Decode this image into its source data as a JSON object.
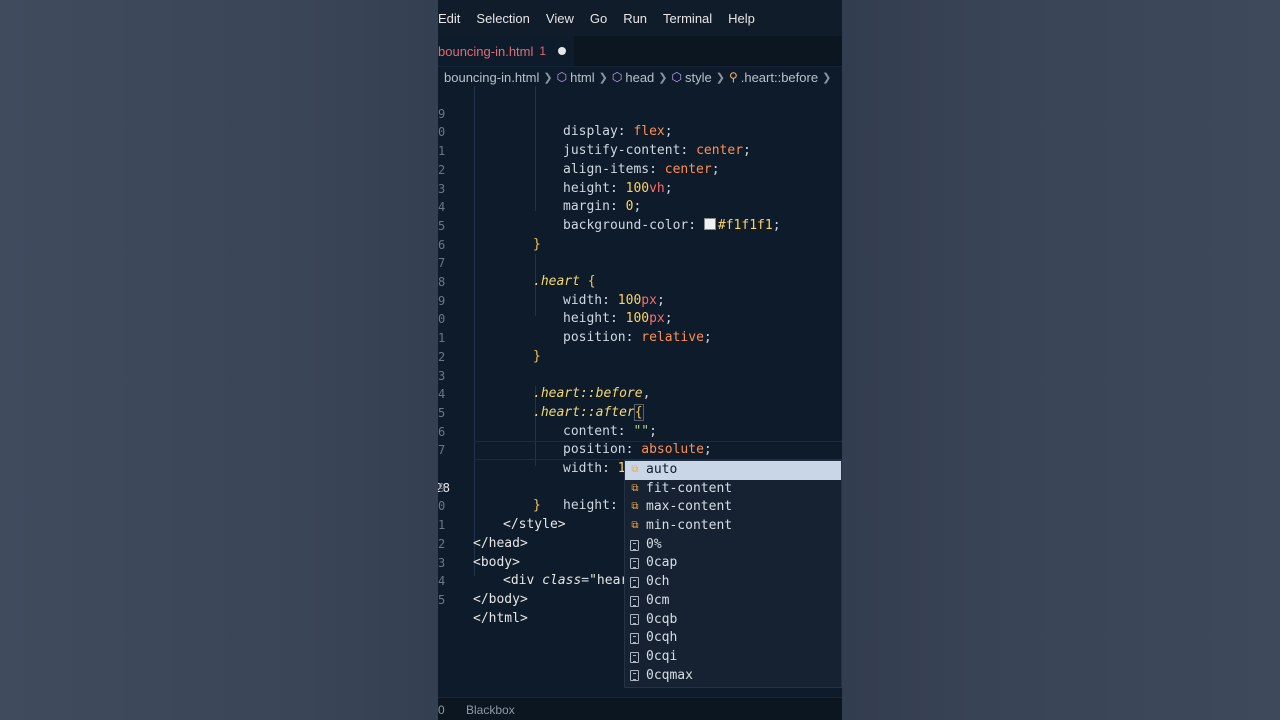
{
  "menu": [
    "Edit",
    "Selection",
    "View",
    "Go",
    "Run",
    "Terminal",
    "Help"
  ],
  "tab": {
    "name": "bouncing-in.html",
    "problems": "1"
  },
  "breadcrumb": [
    {
      "label": "bouncing-in.html",
      "icon": ""
    },
    {
      "label": "html",
      "icon": "element-icon"
    },
    {
      "label": "head",
      "icon": "element-icon"
    },
    {
      "label": "style",
      "icon": "element-icon"
    },
    {
      "label": ".heart::before",
      "icon": "selector-icon"
    }
  ],
  "lines": [
    {
      "num": "9",
      "active": false
    },
    {
      "num": "0",
      "active": false
    },
    {
      "num": "1",
      "active": false
    },
    {
      "num": "2",
      "active": false
    },
    {
      "num": "3",
      "active": false
    },
    {
      "num": "4",
      "active": false
    },
    {
      "num": "5",
      "active": false
    },
    {
      "num": "6",
      "active": false
    },
    {
      "num": "7",
      "active": false
    },
    {
      "num": "8",
      "active": false
    },
    {
      "num": "9",
      "active": false
    },
    {
      "num": "0",
      "active": false
    },
    {
      "num": "1",
      "active": false
    },
    {
      "num": "2",
      "active": false
    },
    {
      "num": "3",
      "active": false
    },
    {
      "num": "4",
      "active": false
    },
    {
      "num": "5",
      "active": false
    },
    {
      "num": "6",
      "active": false
    },
    {
      "num": "7",
      "active": false
    },
    {
      "num": "28",
      "active": true
    },
    {
      "num": "9",
      "active": false
    },
    {
      "num": "0",
      "active": false
    },
    {
      "num": "1",
      "active": false
    },
    {
      "num": "2",
      "active": false
    },
    {
      "num": "3",
      "active": false
    },
    {
      "num": "4",
      "active": false
    },
    {
      "num": "5",
      "active": false
    }
  ],
  "code": {
    "l0": {
      "p": "display",
      "v": "flex"
    },
    "l1": {
      "p": "justify-content",
      "v": "center"
    },
    "l2": {
      "p": "align-items",
      "v": "center"
    },
    "l3": {
      "p": "height",
      "n": "100",
      "u": "vh"
    },
    "l4": {
      "p": "margin",
      "n": "0"
    },
    "l5": {
      "p": "background-color",
      "v": "#f1f1f1"
    },
    "l8": {
      "sel": ".heart"
    },
    "l9": {
      "p": "width",
      "n": "100",
      "u": "px"
    },
    "l10": {
      "p": "height",
      "n": "100",
      "u": "px"
    },
    "l11": {
      "p": "position",
      "v": "relative"
    },
    "l14": {
      "sel": ".heart::before"
    },
    "l15": {
      "sel": ".heart::after"
    },
    "l16": {
      "p": "content",
      "v": "\"\""
    },
    "l17": {
      "p": "position",
      "v": "absolute"
    },
    "l18": {
      "p": "width",
      "n": "100",
      "u": "px"
    },
    "l19": {
      "p": "height"
    },
    "l21": {
      "tag": "</style>"
    },
    "l22": {
      "tag": "</head>"
    },
    "l23": {
      "tag": "<body>"
    },
    "l24": {
      "tag": "<div",
      "attr": "class",
      "str": "\"hear"
    },
    "l25": {
      "tag": "</body>"
    },
    "l26": {
      "tag": "</html>"
    }
  },
  "suggestions": [
    {
      "label": "auto",
      "icon": "value-icon",
      "selected": true
    },
    {
      "label": "fit-content",
      "icon": "value-icon",
      "selected": false
    },
    {
      "label": "max-content",
      "icon": "value-icon",
      "selected": false
    },
    {
      "label": "min-content",
      "icon": "value-icon",
      "selected": false
    },
    {
      "label": "0%",
      "icon": "unit-icon",
      "selected": false
    },
    {
      "label": "0cap",
      "icon": "unit-icon",
      "selected": false
    },
    {
      "label": "0ch",
      "icon": "unit-icon",
      "selected": false
    },
    {
      "label": "0cm",
      "icon": "unit-icon",
      "selected": false
    },
    {
      "label": "0cqb",
      "icon": "unit-icon",
      "selected": false
    },
    {
      "label": "0cqh",
      "icon": "unit-icon",
      "selected": false
    },
    {
      "label": "0cqi",
      "icon": "unit-icon",
      "selected": false
    },
    {
      "label": "0cqmax",
      "icon": "unit-icon",
      "selected": false
    }
  ],
  "status": {
    "left": "0",
    "extension": "Blackbox"
  },
  "colors": {
    "editor_bg": "#0d1b2a",
    "swatch": "#f1f1f1",
    "selection": "#c9d6e8"
  }
}
